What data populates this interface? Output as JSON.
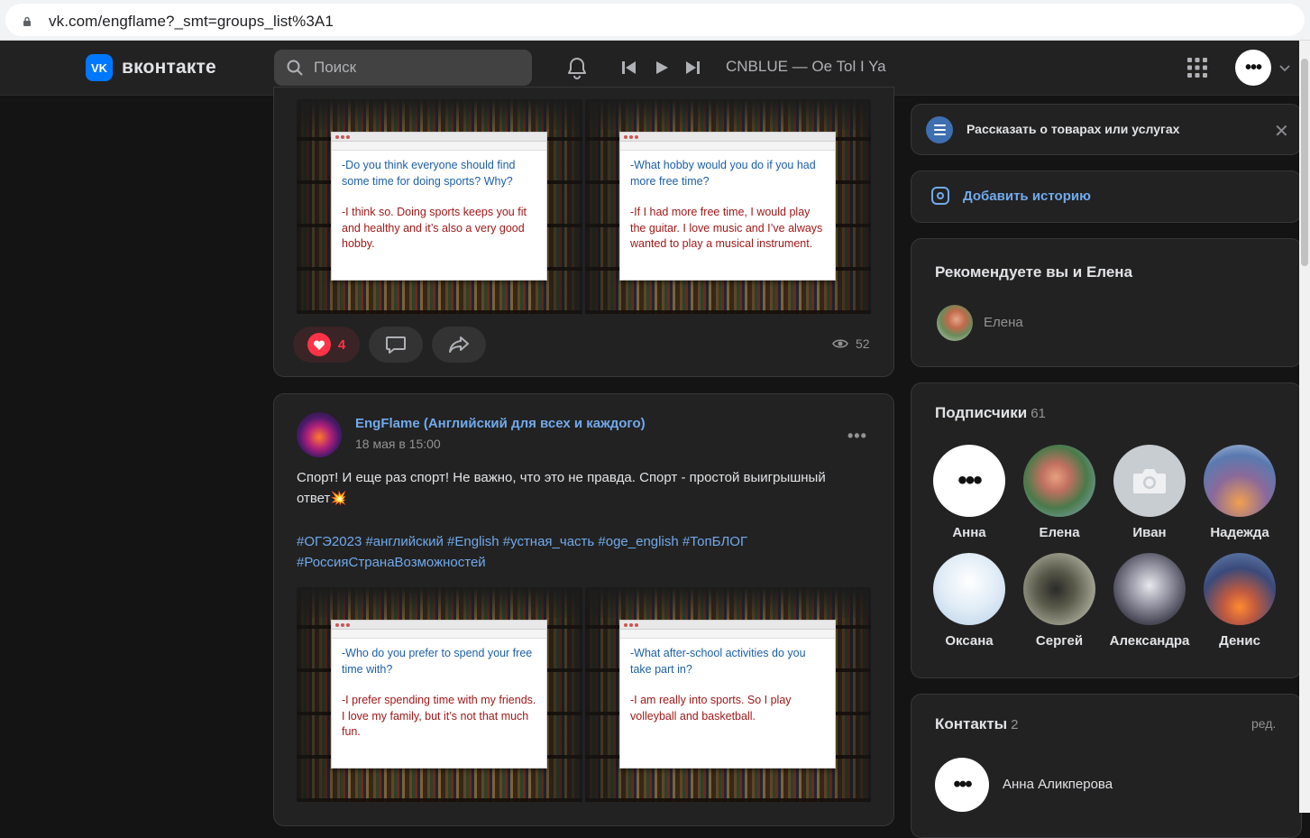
{
  "browser": {
    "url": "vk.com/engflame?_smt=groups_list%3A1"
  },
  "header": {
    "logo_text": "вконтакте",
    "logo_mark": "VK",
    "search_placeholder": "Поиск",
    "now_playing": "CNBLUE — Oe Tol I Ya",
    "menu_dots": "•••",
    "icons": [
      "bell-icon",
      "prev-track-icon",
      "play-icon",
      "next-track-icon",
      "apps-grid-icon",
      "chevron-down-icon"
    ]
  },
  "post1": {
    "photos": [
      {
        "question": "-Do you think everyone should find some time for doing sports? Why?",
        "answer": "-I think so. Doing sports keeps you fit and healthy and it’s also a very good hobby."
      },
      {
        "question": "-What hobby would you do if you had more free time?",
        "answer": "-If I had more free time, I would play the guitar. I love music and I’ve always wanted to play a musical instrument."
      }
    ],
    "likes": "4",
    "views": "52"
  },
  "post2": {
    "author": "EngFlame (Английский для всех и каждого)",
    "date": "18 мая в 15:00",
    "more": "•••",
    "text": "Спорт! И еще раз спорт! Не важно, что это не правда. Спорт - простой выигрышный ответ",
    "emoji": "💥",
    "tags_line1": "#ОГЭ2023 #английский #English #устная_часть #oge_english #ТопБЛОГ",
    "tags_line2": "#РоссияСтранаВозможностей",
    "photos": [
      {
        "question": "-Who do you prefer to spend your free time with?",
        "answer": "-I prefer spending time with my friends. I love my family, but it’s not that much fun."
      },
      {
        "question": "-What after-school activities do you take part in?",
        "answer": "-I am really into sports. So I play volleyball and basketball."
      }
    ]
  },
  "sidebar": {
    "promo": {
      "label": "Рассказать о товарах или услугах",
      "close": "✕"
    },
    "story": {
      "label": "Добавить историю"
    },
    "recommend": {
      "title": "Рекомендуете вы и Елена",
      "friend": "Елена"
    },
    "subscribers": {
      "title": "Подписчики",
      "count": "61",
      "people": [
        {
          "name": "Анна",
          "dots": "•••"
        },
        {
          "name": "Елена"
        },
        {
          "name": "Иван"
        },
        {
          "name": "Надежда"
        },
        {
          "name": "Оксана"
        },
        {
          "name": "Сергей"
        },
        {
          "name": "Александра"
        },
        {
          "name": "Денис"
        }
      ]
    },
    "contacts": {
      "title": "Контакты",
      "count": "2",
      "edit": "ред.",
      "first": {
        "name": "Анна Аликперова",
        "dots": "•••"
      }
    }
  }
}
